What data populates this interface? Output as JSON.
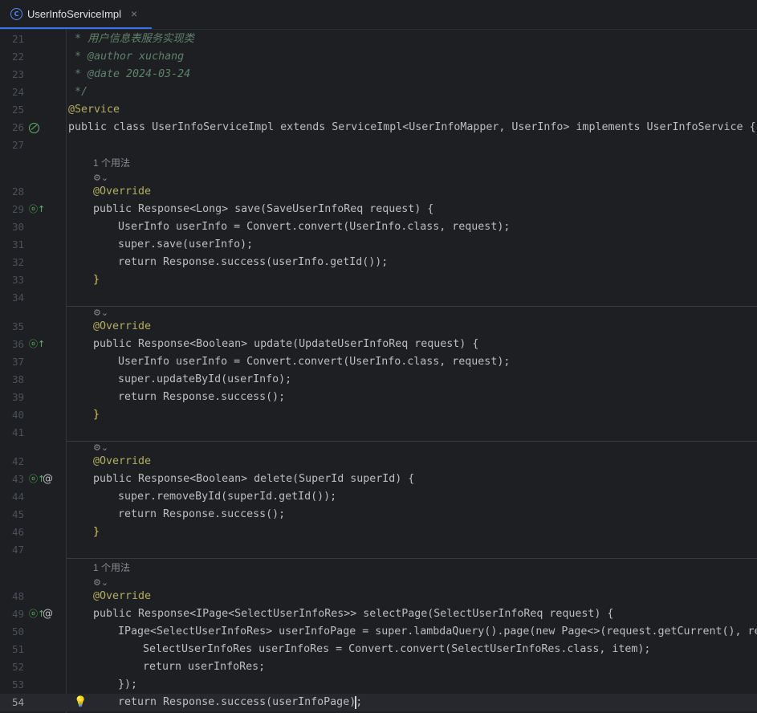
{
  "tab": {
    "icon": "class-icon",
    "icon_glyph": "C",
    "label": "UserInfoServiceImpl",
    "close": "×"
  },
  "colors": {
    "accent": "#3574f0",
    "background": "#1e1f22",
    "keyword": "#cf8e6d",
    "annotation": "#b3ae60",
    "method": "#56a8f5",
    "comment": "#5f826b"
  },
  "usage_hint": "1 个用法",
  "lines": [
    {
      "n": "21",
      "code": "* 用户信息表服务实现类"
    },
    {
      "n": "22",
      "code": "* @author xuchang"
    },
    {
      "n": "23",
      "code": "* @date 2024-03-24"
    },
    {
      "n": "24",
      "code": "*/"
    },
    {
      "n": "25",
      "code": "@Service"
    },
    {
      "n": "26",
      "code": "public class UserInfoServiceImpl extends ServiceImpl<UserInfoMapper, UserInfo> implements UserInfoService {"
    },
    {
      "n": "27",
      "code": ""
    },
    {
      "n": "28",
      "code": "@Override"
    },
    {
      "n": "29",
      "code": "public Response<Long> save(SaveUserInfoReq request) {"
    },
    {
      "n": "30",
      "code": "UserInfo userInfo = Convert.convert(UserInfo.class, request);"
    },
    {
      "n": "31",
      "code": "super.save(userInfo);"
    },
    {
      "n": "32",
      "code": "return Response.success(userInfo.getId());"
    },
    {
      "n": "33",
      "code": "}"
    },
    {
      "n": "34",
      "code": ""
    },
    {
      "n": "35",
      "code": "@Override"
    },
    {
      "n": "36",
      "code": "public Response<Boolean> update(UpdateUserInfoReq request) {"
    },
    {
      "n": "37",
      "code": "UserInfo userInfo = Convert.convert(UserInfo.class, request);"
    },
    {
      "n": "38",
      "code": "super.updateById(userInfo);"
    },
    {
      "n": "39",
      "code": "return Response.success();"
    },
    {
      "n": "40",
      "code": "}"
    },
    {
      "n": "41",
      "code": ""
    },
    {
      "n": "42",
      "code": "@Override"
    },
    {
      "n": "43",
      "code": "public Response<Boolean> delete(SuperId superId) {"
    },
    {
      "n": "44",
      "code": "super.removeById(superId.getId());"
    },
    {
      "n": "45",
      "code": "return Response.success();"
    },
    {
      "n": "46",
      "code": "}"
    },
    {
      "n": "47",
      "code": ""
    },
    {
      "n": "48",
      "code": "@Override"
    },
    {
      "n": "49",
      "code": "public Response<IPage<SelectUserInfoRes>> selectPage(SelectUserInfoReq request) {"
    },
    {
      "n": "50",
      "code": "IPage<SelectUserInfoRes> userInfoPage = super.lambdaQuery().page(new Page<>(request.getCurrent(), requ"
    },
    {
      "n": "51",
      "code": "SelectUserInfoRes userInfoRes = Convert.convert(SelectUserInfoRes.class, item);"
    },
    {
      "n": "52",
      "code": "return userInfoRes;"
    },
    {
      "n": "53",
      "code": "});"
    },
    {
      "n": "54",
      "code": "return Response.success(userInfoPage);"
    }
  ]
}
